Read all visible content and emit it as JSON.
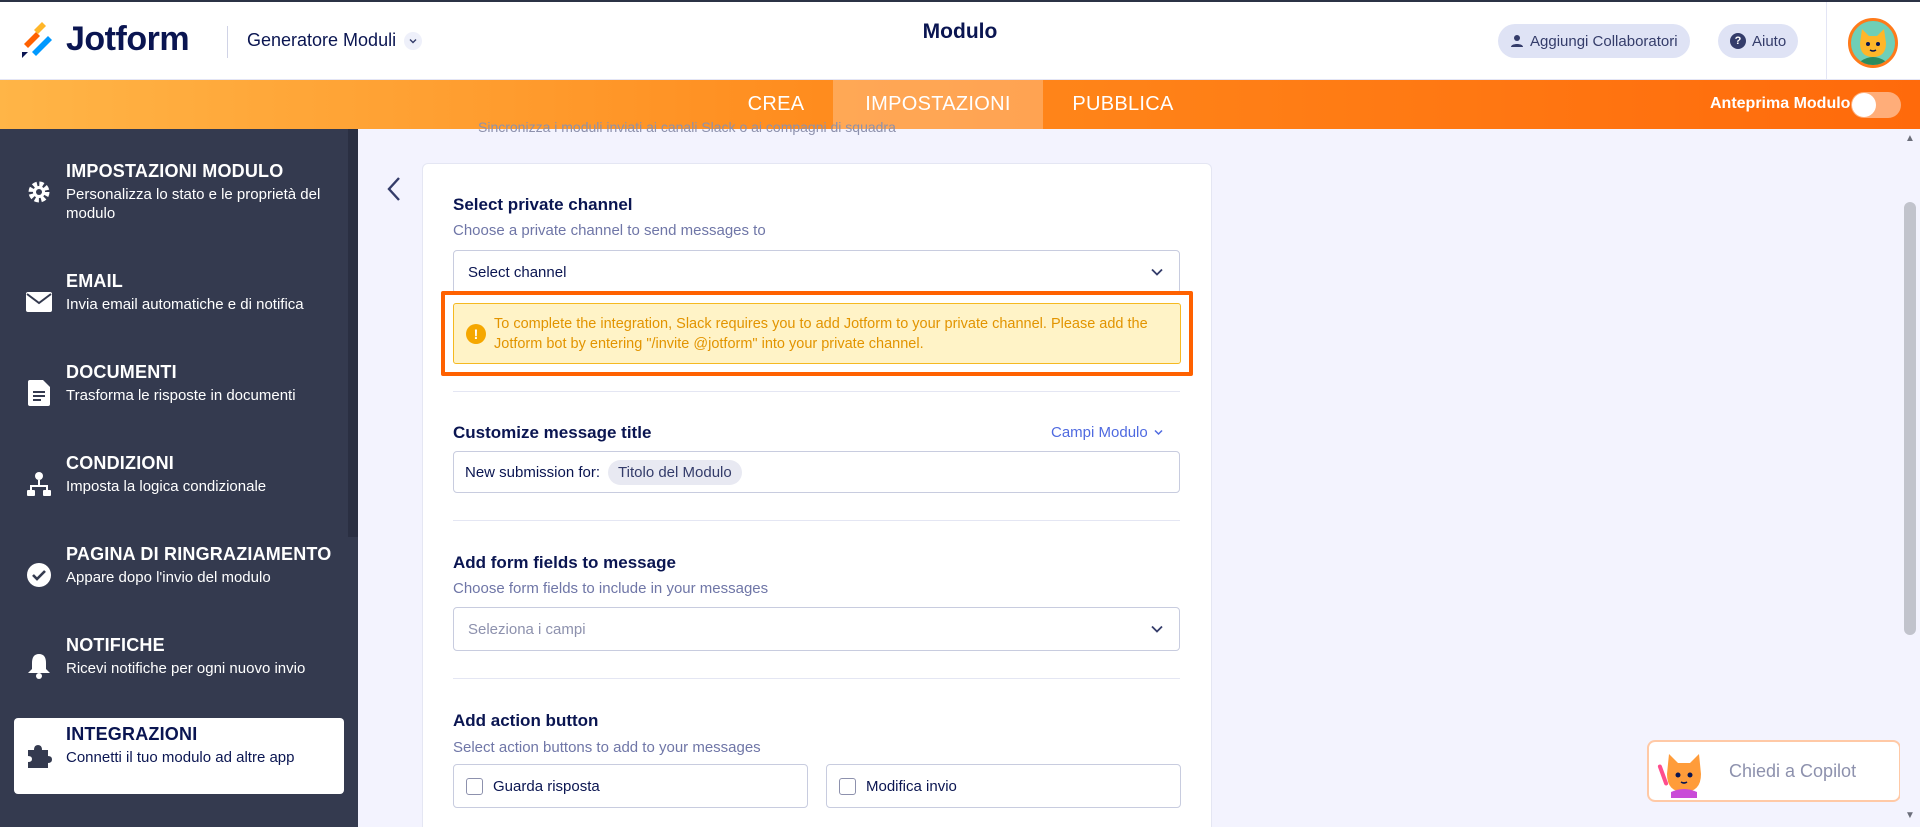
{
  "header": {
    "logo_text": "Jotform",
    "builder_title": "Generatore Moduli",
    "page_title": "Modulo",
    "collab_label": "Aggiungi Collaboratori",
    "help_label": "Aiuto"
  },
  "nav": {
    "tabs": [
      {
        "label": "CREA",
        "active": false
      },
      {
        "label": "IMPOSTAZIONI",
        "active": true
      },
      {
        "label": "PUBBLICA",
        "active": false
      }
    ],
    "preview_label": "Anteprima Modulo",
    "preview_on": false
  },
  "sidebar": {
    "items": [
      {
        "title": "IMPOSTAZIONI MODULO",
        "desc": "Personalizza lo stato e le proprietà del modulo",
        "icon": "gear-icon"
      },
      {
        "title": "EMAIL",
        "desc": "Invia email automatiche e di notifica",
        "icon": "envelope-icon"
      },
      {
        "title": "DOCUMENTI",
        "desc": "Trasforma le risposte in documenti",
        "icon": "document-icon"
      },
      {
        "title": "CONDIZIONI",
        "desc": "Imposta la logica condizionale",
        "icon": "flowchart-icon"
      },
      {
        "title": "PAGINA DI RINGRAZIAMENTO",
        "desc": "Appare dopo l'invio del modulo",
        "icon": "check-circle-icon"
      },
      {
        "title": "NOTIFICHE",
        "desc": "Ricevi notifiche per ogni nuovo invio",
        "icon": "bell-icon"
      },
      {
        "title": "INTEGRAZIONI",
        "desc": "Connetti il tuo modulo ad altre app",
        "icon": "puzzle-icon",
        "active": true
      }
    ]
  },
  "main": {
    "faded_note": "Sincronizza i moduli inviati ai canali Slack o ai compagni di squadra",
    "private_channel": {
      "title": "Select private channel",
      "subtitle": "Choose a private channel to send messages to",
      "select_value": "Select channel"
    },
    "warning": "To complete the integration, Slack requires you to add Jotform to your private channel. Please add the Jotform bot by entering \"/invite @jotform\" into your private channel.",
    "message_title": {
      "title": "Customize message title",
      "fields_link": "Campi Modulo",
      "prefix": "New submission for:",
      "chip": "Titolo del Modulo"
    },
    "form_fields": {
      "title": "Add form fields to message",
      "subtitle": "Choose form fields to include in your messages",
      "placeholder": "Seleziona i campi"
    },
    "action_button": {
      "title": "Add action button",
      "subtitle": "Select action buttons to add to your messages",
      "options": [
        "Guarda risposta",
        "Modifica invio"
      ]
    }
  },
  "copilot": {
    "label": "Chiedi a Copilot"
  },
  "colors": {
    "accent": "#ff6100",
    "sidebar": "#343a4f",
    "warning_bg": "#fff3c7",
    "warning_text": "#e29400"
  }
}
